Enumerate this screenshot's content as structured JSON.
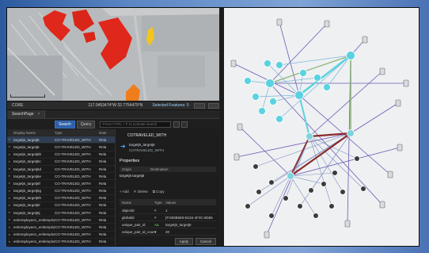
{
  "toolbar": {
    "left_label": "CORE",
    "coordinates": "117.0453474°W 32.7754479°N",
    "selected_features": "Selected Features: 0"
  },
  "panel": {
    "tab_label": "SearchPage",
    "search_button": "Search",
    "query_button": "Query",
    "search_placeholder": "Press CTRL + F to activate search"
  },
  "table": {
    "headers": [
      "Display Name",
      "Type",
      "Date"
    ],
    "rows": [
      [
        "targetj5_targetj6",
        "CO-TRAVELED_WITH",
        "Rela"
      ],
      [
        "targetj6_targetj6",
        "CO-TRAVELED_WITH",
        "Rela"
      ],
      [
        "targetj6_targetj6b",
        "CO-TRAVELED_WITH",
        "Rela"
      ],
      [
        "targetj6_targetj6c",
        "CO-TRAVELED_WITH",
        "Rela"
      ],
      [
        "targetj6_targetj6d",
        "CO-TRAVELED_WITH",
        "Rela"
      ],
      [
        "targetj6_targetj6e",
        "CO-TRAVELED_WITH",
        "Rela"
      ],
      [
        "targetj6_targetj6f",
        "CO-TRAVELED_WITH",
        "Rela"
      ],
      [
        "targetj6_targetj6g",
        "CO-TRAVELED_WITH",
        "Rela"
      ],
      [
        "targetj6_targetj6h",
        "CO-TRAVELED_WITH",
        "Rela"
      ],
      [
        "targetj6_targetj6i",
        "CO-TRAVELED_WITH",
        "Rela"
      ],
      [
        "targetj6_targetj6j",
        "CO-TRAVELED_WITH",
        "Rela"
      ],
      [
        "emlemployee1_emlemployee16",
        "CO-TRAVELED_WITH",
        "Rela"
      ],
      [
        "emlemployee1_emlemployee17",
        "CO-TRAVELED_WITH",
        "Rela"
      ],
      [
        "emlemployee1_emlemployee18",
        "CO-TRAVELED_WITH",
        "Rela"
      ],
      [
        "emlemployee1_emlemployee19",
        "CO-TRAVELED_WITH",
        "Rela"
      ]
    ]
  },
  "details": {
    "title": "COTRAVELED_WITH",
    "source_label": "targetj5_targetj6",
    "type_label": "COTRAVELED_WITH",
    "properties_heading": "Properties",
    "origin_header": "Origin",
    "destination_header": "Destination",
    "origin_value": "targetj6 targetj6",
    "add_label": "Add",
    "delete_label": "Delete",
    "copy_label": "Copy",
    "fields_headers": [
      "Name",
      "Type",
      "Values"
    ],
    "fields": [
      {
        "name": "objectid",
        "type": "#",
        "value": "1"
      },
      {
        "name": "globalid",
        "type": "#",
        "value": "{F34DB5E8-B116-4F3C-B565-FE7180..."
      },
      {
        "name": "unique_pair_id",
        "type": "Aa",
        "value": "targetj6_targetj6"
      },
      {
        "name": "unique_pair_id_count",
        "type": "#",
        "value": "20"
      }
    ],
    "apply_button": "Apply",
    "cancel_button": "Cancel"
  },
  "colors": {
    "accent": "#2d5fa8",
    "hub_node": "#5ad2e0",
    "red_edge": "#8b2a2a",
    "purple_edge": "#6e5ab4",
    "green_edge": "#8cb47a"
  }
}
